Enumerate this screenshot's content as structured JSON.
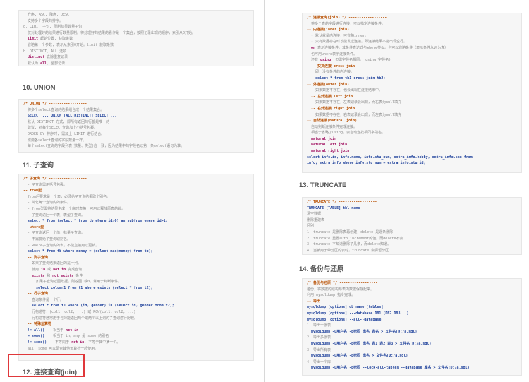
{
  "left_page": {
    "top_block": [
      [
        [
          "  升序, ASC, 降序, DESC",
          "cm"
        ]
      ],
      [
        [
          "  支持多个字段的排序。",
          "cm"
        ]
      ],
      [
        [
          "g. LIMIT 子句, 限制结果数量子句",
          "cm"
        ]
      ],
      [
        [
          "  仅对处理好的结果进行数量限制。将处理好的结果的看作是一个集合，按照记录出现的顺序，索引从0开始。",
          "cm"
        ]
      ],
      [
        [
          "  limit",
          "kw"
        ],
        [
          " 起始位置, 获取条数",
          "cm"
        ]
      ],
      [
        [
          "  省略第一个参数, 表示从索引0开始。limit 获取条数",
          "cm"
        ]
      ],
      [
        [
          "h. DISTINCT, ALL 选项",
          "cm"
        ]
      ],
      [
        [
          "  distinct",
          "kw"
        ],
        [
          " 去除重复记录",
          "cm"
        ]
      ],
      [
        [
          "  默认为 ",
          "cm"
        ],
        [
          "all",
          "kw"
        ],
        [
          ", 全部记录",
          "cm"
        ]
      ]
    ],
    "union_heading": "10. UNION",
    "union_block": [
      [
        [
          "/* UNION */ ------------------",
          "ch"
        ]
      ],
      [
        [
          "  将多个select查询的结果组合成一个结果集合。",
          "cm"
        ]
      ],
      [
        [
          "  SELECT ... UNION [ALL|DISTINCT] SELECT ...",
          "bl"
        ]
      ],
      [
        [
          "  默认 DISTINCT 方式, 即所有返回的行都是唯一的",
          "cm"
        ]
      ],
      [
        [
          "  建议, 对每个SELECT查询加上小括号包裹。",
          "cm"
        ]
      ],
      [
        [
          "  ORDER BY 排序时, 需加上 LIMIT 进行结合。",
          "cm"
        ]
      ],
      [
        [
          "  需要各select查询的字段数量一样。",
          "cm"
        ]
      ],
      [
        [
          "  每个select查询的字段列表(数量、类型)应一致，因为结果中的字段名以第一条select语句为准。",
          "cm"
        ]
      ]
    ],
    "subquery_heading": "11. 子查询",
    "subquery_block": [
      [
        [
          "/* 子查询 */ ------------------",
          "ch"
        ]
      ],
      [
        [
          "  - 子查询需用括号包裹。",
          "cm"
        ]
      ],
      [
        [
          "-- from型",
          "ch"
        ]
      ],
      [
        [
          "  from后要求是一个表，必须给子查询结果取个别名。",
          "cm"
        ]
      ],
      [
        [
          "  - 简化每个查询内的条件。",
          "cm"
        ]
      ],
      [
        [
          "  - from型需将结果生成一个临时表格，可用以释放原表的锁。",
          "cm"
        ]
      ],
      [
        [
          "  - 子查询返回一个表，表型子查询。",
          "cm"
        ]
      ],
      [
        [
          "  select * from (select * from tb where id>0) as subfrom where id>1;",
          "bl"
        ]
      ],
      [
        [
          "-- where型",
          "ch"
        ]
      ],
      [
        [
          "  - 子查询返回一个值，标量子查询。",
          "cm"
        ]
      ],
      [
        [
          "  - 不需要给子查询取别名。",
          "cm"
        ]
      ],
      [
        [
          "  - where子查询内的表，不能直接用以更新。",
          "cm"
        ]
      ],
      [
        [
          "  select * from tb where money = (select max(money) from tb);",
          "bl"
        ]
      ],
      [
        [
          "  -- 列子查询",
          "ch"
        ]
      ],
      [
        [
          "    如果子查询结果返回的是一列。",
          "cm"
        ]
      ],
      [
        [
          "    使用 ",
          "cm"
        ],
        [
          "in",
          "kw"
        ],
        [
          " 或 ",
          "cm"
        ],
        [
          "not in",
          "kw"
        ],
        [
          " 完成查询",
          "cm"
        ]
      ],
      [
        [
          "    exists",
          "kw"
        ],
        [
          " 和 ",
          "cm"
        ],
        [
          "not exists",
          "kw"
        ],
        [
          " 条件",
          "cm"
        ]
      ],
      [
        [
          "      如果子查询返回数据，则返回1或0。常用于判断条件。",
          "cm"
        ]
      ],
      [
        [
          "      select column1 from t1 where exists (select * from t2);",
          "bl"
        ]
      ],
      [
        [
          "  -- 行子查询",
          "ch"
        ]
      ],
      [
        [
          "    查询条件是一个行。",
          "cm"
        ]
      ],
      [
        [
          "    select * from t1 where (id, gender) in (select id, gender from t2);",
          "bl"
        ]
      ],
      [
        [
          "    行构造符：(col1, col2, ...) 或 ROW(col1, col2, ...)",
          "cm"
        ]
      ],
      [
        [
          "    行构造符通常用于与对能返回两个或两个以上列的子查询进行比较。",
          "cm"
        ]
      ],
      [
        [
          "  -- 特殊运算符",
          "ch"
        ]
      ],
      [
        [
          "  != all()",
          "bl"
        ],
        [
          "    相当于 ",
          "cm"
        ],
        [
          "not in",
          "kw"
        ]
      ],
      [
        [
          "  = some()",
          "bl"
        ],
        [
          "    相当于 in。any 是 some 的别名",
          "cm"
        ]
      ],
      [
        [
          "  != some()",
          "bl"
        ],
        [
          "    不等同于 ",
          "cm"
        ],
        [
          "not in",
          "kw"
        ],
        [
          ", 不等于其中某一个。",
          "cm"
        ]
      ],
      [
        [
          "  all, some 可以配合其他运算符一起使用。",
          "cm"
        ]
      ]
    ],
    "join_heading": "12. 连接查询(join)"
  },
  "right_page": {
    "join_block": [
      [
        [
          "/* 连接查询(join) */ ------------------",
          "ch"
        ]
      ],
      [
        [
          "  将多个表的字段进行连接，可以指定连接条件。",
          "cm"
        ]
      ],
      [
        [
          "-- 内连接(inner join)",
          "ch"
        ]
      ],
      [
        [
          "  - 默认就是内连接，可省略inner。",
          "cm"
        ]
      ],
      [
        [
          "  - 只有数据存在时才能发送连接。即连接结果不能出现空行。",
          "cm"
        ]
      ],
      [
        [
          "  on",
          "kw"
        ],
        [
          " 表示连接条件。其条件表达式与where类似。也可以省略条件（表示条件永远为真）",
          "cm"
        ]
      ],
      [
        [
          "  也可用where表示连接条件。",
          "cm"
        ]
      ],
      [
        [
          "  还有 ",
          "cm"
        ],
        [
          "using",
          "kw"
        ],
        [
          ", 但需字段名相同。 using(字段名)",
          "cm"
        ]
      ],
      [
        [
          "  -- 交叉连接 cross join",
          "ch"
        ]
      ],
      [
        [
          "    即，没有条件的内连接。",
          "cm"
        ]
      ],
      [
        [
          "    select * from tb1 cross join tb2;",
          "bl"
        ]
      ],
      [
        [
          "-- 外连接(outer join)",
          "ch"
        ]
      ],
      [
        [
          "  - 如果数据不存在，也会出现在连接结果中。",
          "cm"
        ]
      ],
      [
        [
          "  -- 左外连接 left join",
          "ch"
        ]
      ],
      [
        [
          "    如果数据不存在，左表记录会出现，而右表为null填充",
          "cm"
        ]
      ],
      [
        [
          "  -- 右外连接 right join",
          "ch"
        ]
      ],
      [
        [
          "    如果数据不存在，右表记录会出现，而左表为null填充",
          "cm"
        ]
      ],
      [
        [
          "-- 自然连接(natural join)",
          "ch"
        ]
      ],
      [
        [
          "  自动判断连接条件完成连接。",
          "cm"
        ]
      ],
      [
        [
          "  相当于省略了using，会自动查找相同字段名。",
          "cm"
        ]
      ],
      [
        [
          "  natural join",
          "kw"
        ]
      ],
      [
        [
          "  natural left join",
          "kw"
        ]
      ],
      [
        [
          "  natural right join",
          "kw"
        ]
      ],
      [
        [
          "select info.id, info.name, info.stu_num, extra_info.hobby, extra_info.sex from",
          "bl"
        ]
      ],
      [
        [
          "info, extra_info where info.stu_num = extra_info.stu_id;",
          "bl"
        ]
      ]
    ],
    "truncate_heading": "13. TRUNCATE",
    "truncate_block": [
      [
        [
          "/* TRUNCATE */ ------------------",
          "ch"
        ]
      ],
      [
        [
          "TRUNCATE [TABLE] tbl_name",
          "bl"
        ]
      ],
      [
        [
          "清空数据",
          "cm"
        ]
      ],
      [
        [
          "删除重建表",
          "cm"
        ]
      ],
      [
        [
          "区别:",
          "cm"
        ]
      ],
      [
        [
          "1, truncate 是删除表再创建，delete 是逐条删除",
          "cm"
        ]
      ],
      [
        [
          "2, truncate 重置auto_increment的值。而delete不会",
          "cm"
        ]
      ],
      [
        [
          "3, truncate 不知道删除了几条，而delete知道。",
          "cm"
        ]
      ],
      [
        [
          "4, 当被用于带分区的表时，truncate 会保留分区",
          "cm"
        ]
      ]
    ],
    "backup_heading": "14. 备份与还原",
    "backup_block": [
      [
        [
          "/* 备份与还原 */ ------------------",
          "ch"
        ]
      ],
      [
        [
          "备份，将数据的结构与表内数据保存起来。",
          "cm"
        ]
      ],
      [
        [
          "利用 mysqldump 指令完成。",
          "cm"
        ]
      ],
      [
        [
          "-- 导出",
          "ch"
        ]
      ],
      [
        [
          "mysqldump [options] db_name [tables]",
          "bl"
        ]
      ],
      [
        [
          "mysqldump [options] ---database DB1 [DB2 DB3...]",
          "bl"
        ]
      ],
      [
        [
          "mysqldump [options] --all--database",
          "bl"
        ]
      ],
      [
        [
          "1. 导出一张表",
          "cm"
        ]
      ],
      [
        [
          "  mysqldump -u用户名 -p密码 库名 表名 > 文件名(D:/a.sql)",
          "bl"
        ]
      ],
      [
        [
          "2. 导出多张表",
          "cm"
        ]
      ],
      [
        [
          "  mysqldump -u用户名 -p密码 库名 表1 表2 表3 > 文件名(D:/a.sql)",
          "bl"
        ]
      ],
      [
        [
          "3. 导出所有表",
          "cm"
        ]
      ],
      [
        [
          "  mysqldump -u用户名 -p密码 库名 > 文件名(D:/a.sql)",
          "bl"
        ]
      ],
      [
        [
          "4. 导出一个库",
          "cm"
        ]
      ],
      [
        [
          "  mysqldump -u用户名 -p密码 --lock-all-tables --database 库名 > 文件名(D:/a.sql)",
          "bl"
        ]
      ]
    ]
  }
}
